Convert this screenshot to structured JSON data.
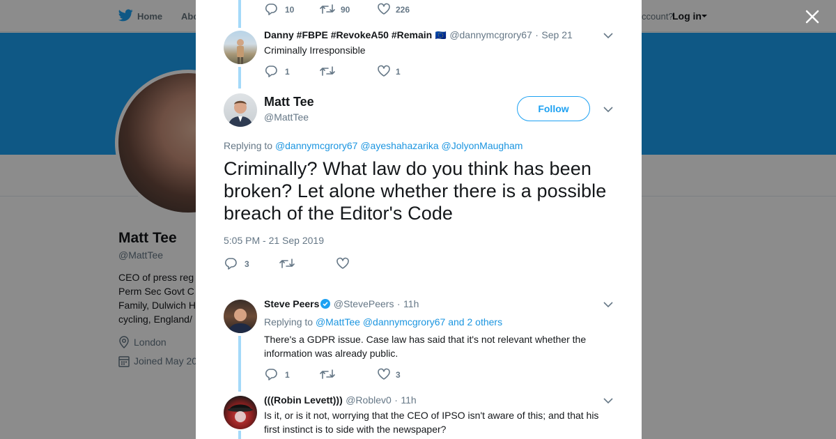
{
  "background": {
    "nav": {
      "home": "Home",
      "about": "Abo",
      "account": "ccount?",
      "login": "Log in"
    },
    "profile": {
      "name": "Matt Tee",
      "handle": "@MattTee",
      "bio_lines": [
        "CEO of press reg",
        "Perm Sec Govt C",
        "Family, Dulwich H",
        "cycling, England/"
      ],
      "location": "London",
      "joined": "Joined May 20"
    },
    "colors": {
      "banner": "#1da1f2"
    }
  },
  "modal": {
    "top_actions": {
      "replies": "10",
      "retweets": "90",
      "likes": "226"
    },
    "parent_tweet": {
      "name": "Danny #FBPE #RevokeA50 #Remain",
      "flag": "🇪🇺",
      "handle": "@dannymcgrory67",
      "sep": "·",
      "time": "Sep 21",
      "text": "Criminally Irresponsible",
      "replies": "1",
      "likes": "1"
    },
    "main_tweet": {
      "name": "Matt Tee",
      "handle": "@MattTee",
      "follow_label": "Follow",
      "replying_label": "Replying to",
      "replying_to": [
        "@dannymcgrory67",
        "@ayeshahazarika",
        "@JolyonMaugham"
      ],
      "text": "Criminally? What law do you think has been broken? Let alone whether there is a possible breach of the Editor's Code",
      "timestamp": "5:05 PM - 21 Sep 2019",
      "replies": "3"
    },
    "replies": [
      {
        "name": "Steve Peers",
        "verified": true,
        "handle": "@StevePeers",
        "sep": "·",
        "time": "11h",
        "replying_label": "Replying to",
        "replying_to": [
          "@MattTee",
          "@dannymcgrory67"
        ],
        "and_others": "and 2 others",
        "text": "There's a GDPR issue. Case law has said that it's not relevant whether the information was already public.",
        "replies": "1",
        "likes": "3"
      },
      {
        "name": "(((Robin Levett)))",
        "handle": "@Roblev0",
        "sep": "·",
        "time": "11h",
        "text": "Is it, or is it not, worrying that the CEO of IPSO isn't aware of this; and that his first instinct is to side with the newspaper?"
      }
    ],
    "icons": [
      "reply-icon",
      "retweet-icon",
      "like-icon",
      "chevron-down-icon",
      "verified-icon",
      "close-icon",
      "twitter-bird-icon",
      "location-icon",
      "calendar-icon"
    ],
    "colors": {
      "link": "#1b95e0",
      "thread_line": "#a4d9f9",
      "muted": "#657786"
    }
  }
}
